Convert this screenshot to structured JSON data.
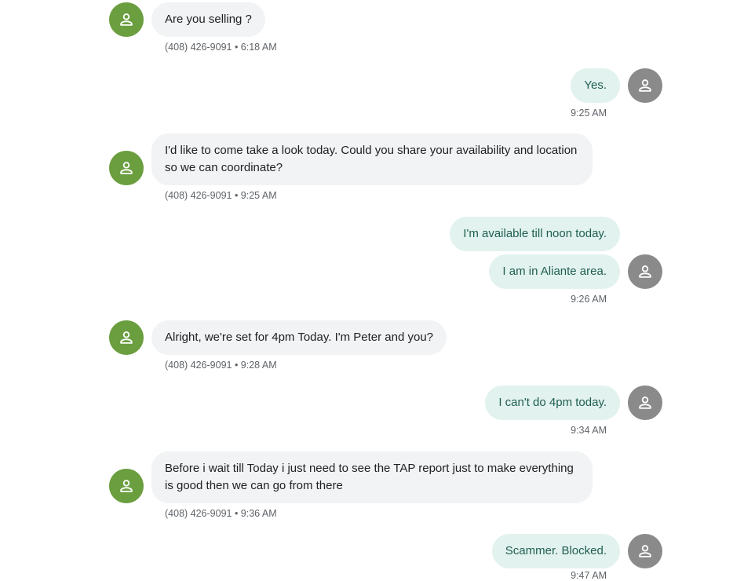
{
  "messages": [
    {
      "dir": "in",
      "text": "Are you selling ?",
      "meta": "(408) 426-9091 • 6:18 AM"
    },
    {
      "dir": "out",
      "text": "Yes.",
      "meta": "9:25 AM"
    },
    {
      "dir": "in",
      "text": "I'd like to come take a look today. Could you share your availability and location so we can coordinate?",
      "meta": "(408) 426-9091 • 9:25 AM"
    },
    {
      "dir": "out",
      "text": "I'm available till noon today."
    },
    {
      "dir": "out",
      "text": "I am in Aliante area.",
      "meta": "9:26 AM"
    },
    {
      "dir": "in",
      "text": "Alright, we're set for 4pm Today. I'm Peter and you?",
      "meta": "(408) 426-9091 • 9:28 AM"
    },
    {
      "dir": "out",
      "text": "I can't do 4pm today.",
      "meta": "9:34 AM"
    },
    {
      "dir": "in",
      "text": "Before i wait till Today i just need to see the TAP report just to make everything is good then we can go from there",
      "meta": "(408) 426-9091 • 9:36 AM"
    },
    {
      "dir": "out",
      "text": "Scammer. Blocked.",
      "meta": "9:47 AM"
    }
  ],
  "icons": {
    "avatar": "person-icon"
  },
  "colors": {
    "incoming_avatar": "#6a9e3f",
    "outgoing_avatar": "#8a8a8a",
    "incoming_bubble": "#f1f3f4",
    "outgoing_bubble": "#e2f2ef",
    "outgoing_text": "#1f5e50"
  }
}
